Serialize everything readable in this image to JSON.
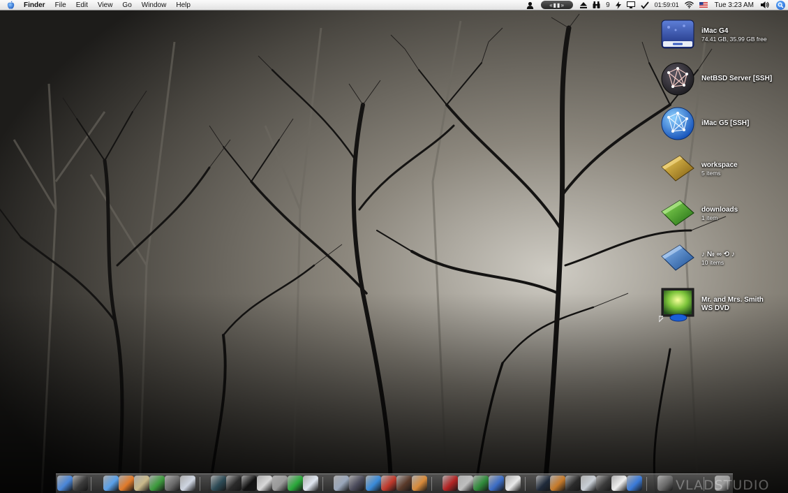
{
  "menubar": {
    "app_name": "Finder",
    "menus": [
      "File",
      "Edit",
      "View",
      "Go",
      "Window",
      "Help"
    ],
    "status": {
      "itunes_controls": "«▮▮»",
      "counter": "9",
      "clock": "01:59:01",
      "datetime": "Tue 3:23 AM"
    }
  },
  "desktop": {
    "items": [
      {
        "name": "iMac G4",
        "subtitle": "74.41 GB, 35.99 GB free",
        "icon": "hard-drive-icon"
      },
      {
        "name": "NetBSD Server [SSH]",
        "subtitle": "",
        "icon": "network-server-icon"
      },
      {
        "name": "iMac G5 [SSH]",
        "subtitle": "",
        "icon": "network-globe-icon"
      },
      {
        "name": "workspace",
        "subtitle": "5 items",
        "icon": "folder-gold-icon"
      },
      {
        "name": "downloads",
        "subtitle": "1 item",
        "icon": "folder-green-icon"
      },
      {
        "name": "♪ № ∞ ⟲ ♪",
        "subtitle": "10 items",
        "icon": "folder-blue-icon"
      },
      {
        "name": "Mr. and Mrs. Smith",
        "name_line2": "WS DVD",
        "subtitle": "",
        "icon": "dvd-alias-icon"
      }
    ]
  },
  "dock": {
    "watermark": "VLADSTUDIO",
    "apps": [
      {
        "name": "finder-icon",
        "color": "#4a86d8"
      },
      {
        "name": "dashboard-icon",
        "color": "#3a3a3a"
      },
      {
        "name": "safari-icon",
        "color": "#5aa0e8"
      },
      {
        "name": "firefox-icon",
        "color": "#e07a2a"
      },
      {
        "name": "camino-icon",
        "color": "#c9b98a"
      },
      {
        "name": "itunes-icon",
        "color": "#3c9a3c"
      },
      {
        "name": "disk-utility-icon",
        "color": "#6a6a6a"
      },
      {
        "name": "preview-icon",
        "color": "#cfd6e2"
      },
      {
        "name": "activity-monitor-icon",
        "color": "#2c4a55"
      },
      {
        "name": "console-icon",
        "color": "#2a2a2a"
      },
      {
        "name": "terminal-icon",
        "color": "#111111"
      },
      {
        "name": "system-preferences-icon",
        "color": "#d8d8d8"
      },
      {
        "name": "calculator-icon",
        "color": "#9a9a9a"
      },
      {
        "name": "x11-icon",
        "color": "#2aa83a"
      },
      {
        "name": "network-icon",
        "color": "#dfe6ef"
      },
      {
        "name": "iphoto-icon",
        "color": "#9aa7bb"
      },
      {
        "name": "photoshop-icon",
        "color": "#4a4a5a"
      },
      {
        "name": "mail-icon",
        "color": "#3a8ad8"
      },
      {
        "name": "app-stat-icon",
        "color": "#c0392b"
      },
      {
        "name": "disc-burner-icon",
        "color": "#5a3a2a"
      },
      {
        "name": "ical-icon",
        "color": "#d88a3a"
      },
      {
        "name": "acrobat-icon",
        "color": "#b22222"
      },
      {
        "name": "grid-calc-icon",
        "color": "#bfbfbf"
      },
      {
        "name": "excel-icon",
        "color": "#2f8a3a"
      },
      {
        "name": "word-icon",
        "color": "#3b6cc4"
      },
      {
        "name": "textedit-icon",
        "color": "#e9e9e9"
      },
      {
        "name": "inkwell-icon",
        "color": "#1f2a3a"
      },
      {
        "name": "garageband-icon",
        "color": "#c67a2a"
      },
      {
        "name": "speaker-icon",
        "color": "#2a2a2a"
      },
      {
        "name": "dvd-player-icon",
        "color": "#c9cfd6"
      },
      {
        "name": "quicktime-icon",
        "color": "#3a3a3a"
      },
      {
        "name": "ipod-icon",
        "color": "#eeeeee"
      },
      {
        "name": "vlc-icon",
        "color": "#3a7ad8"
      },
      {
        "name": "tools-icon",
        "color": "#6a6a6a"
      },
      {
        "name": "trash-icon",
        "color": "#9a9a9a"
      }
    ]
  }
}
